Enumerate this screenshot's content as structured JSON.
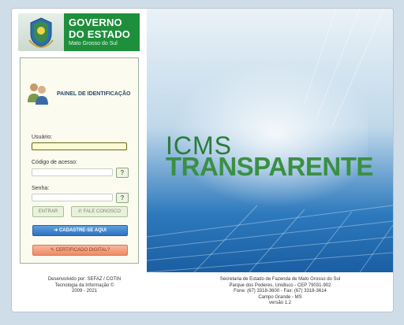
{
  "header": {
    "line1": "GOVERNO",
    "line2": "DO ESTADO",
    "line3": "Mato Grosso do Sul"
  },
  "panel": {
    "title": "PAINEL DE IDENTIFICAÇÃO",
    "user_label": "Usuário:",
    "user_value": "",
    "access_label": "Código de acesso:",
    "access_value": "",
    "password_label": "Senha:",
    "password_value": "",
    "help_glyph": "?",
    "enter_label": "ENTRAR",
    "contact_label": "FALE CONOSCO",
    "register_label": "CADASTRE-SE AQUI",
    "certificate_label": "CERTIFICADO DIGITAL?"
  },
  "hero": {
    "title_top": "ICMS",
    "title_bottom": "TRANSPARENTE"
  },
  "footer": {
    "left": [
      "Desenvolvido por: SEFAZ / COTIN",
      "Tecnologia da Informação ©",
      "2009 - 2021"
    ],
    "right": [
      "Secretaria de Estado de Fazenda de Mato Grosso do Sul",
      "Parque dos Poderes, Unidisco - CEP 79031-902",
      "Fone: (67) 3318-3600 - Fax: (67) 3318-3614",
      "Campo Grande - MS",
      "versão 1.2"
    ]
  },
  "colors": {
    "brand_green": "#1e8f3b",
    "page_bg": "#cfdde8",
    "panel_bg": "#fbfbef"
  }
}
